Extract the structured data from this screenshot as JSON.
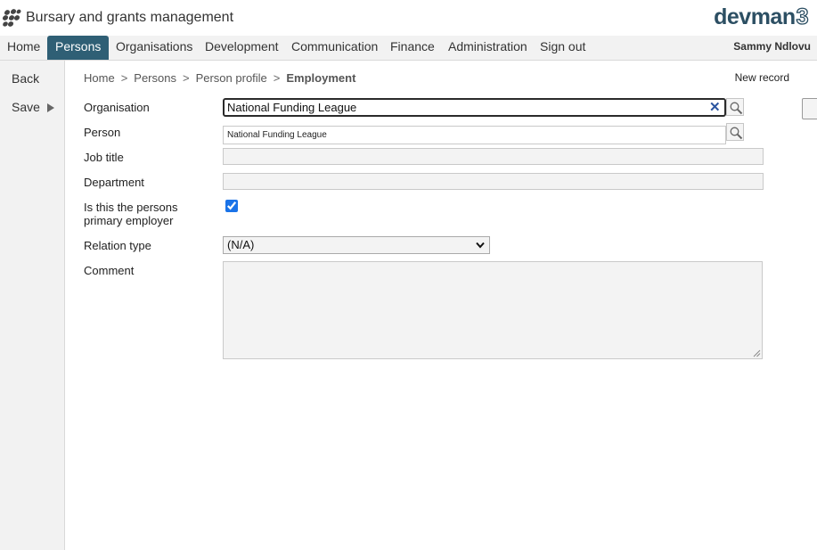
{
  "header": {
    "app_title": "Bursary and grants management",
    "brand_text": "devman",
    "brand_number": "3",
    "brand_color": "#2c4f63"
  },
  "nav": {
    "items": [
      {
        "label": "Home"
      },
      {
        "label": "Persons",
        "active": true
      },
      {
        "label": "Organisations"
      },
      {
        "label": "Development"
      },
      {
        "label": "Communication"
      },
      {
        "label": "Finance"
      },
      {
        "label": "Administration"
      },
      {
        "label": "Sign out"
      }
    ],
    "user": "Sammy Ndlovu",
    "active_color": "#2f5f75"
  },
  "sidebar": {
    "back_label": "Back",
    "save_label": "Save"
  },
  "breadcrumb": {
    "items": [
      "Home",
      "Persons",
      "Person profile"
    ],
    "separator": ">",
    "current": "Employment"
  },
  "new_record_label": "New record",
  "form": {
    "organisation": {
      "label": "Organisation",
      "value": "National Funding League"
    },
    "person": {
      "label": "Person",
      "value": "National Funding League"
    },
    "job_title": {
      "label": "Job title",
      "value": ""
    },
    "department": {
      "label": "Department",
      "value": ""
    },
    "primary_employer": {
      "label_line1": "Is this the persons",
      "label_line2": "primary employer",
      "checked": true
    },
    "relation_type": {
      "label": "Relation type",
      "value": "(N/A)"
    },
    "comment": {
      "label": "Comment",
      "value": ""
    }
  },
  "icons": {
    "clear": "close-icon",
    "lookup": "search-icon",
    "logo": "app-logo-icon",
    "dropdown": "chevron-down-icon",
    "resize": "resize-handle-icon"
  }
}
